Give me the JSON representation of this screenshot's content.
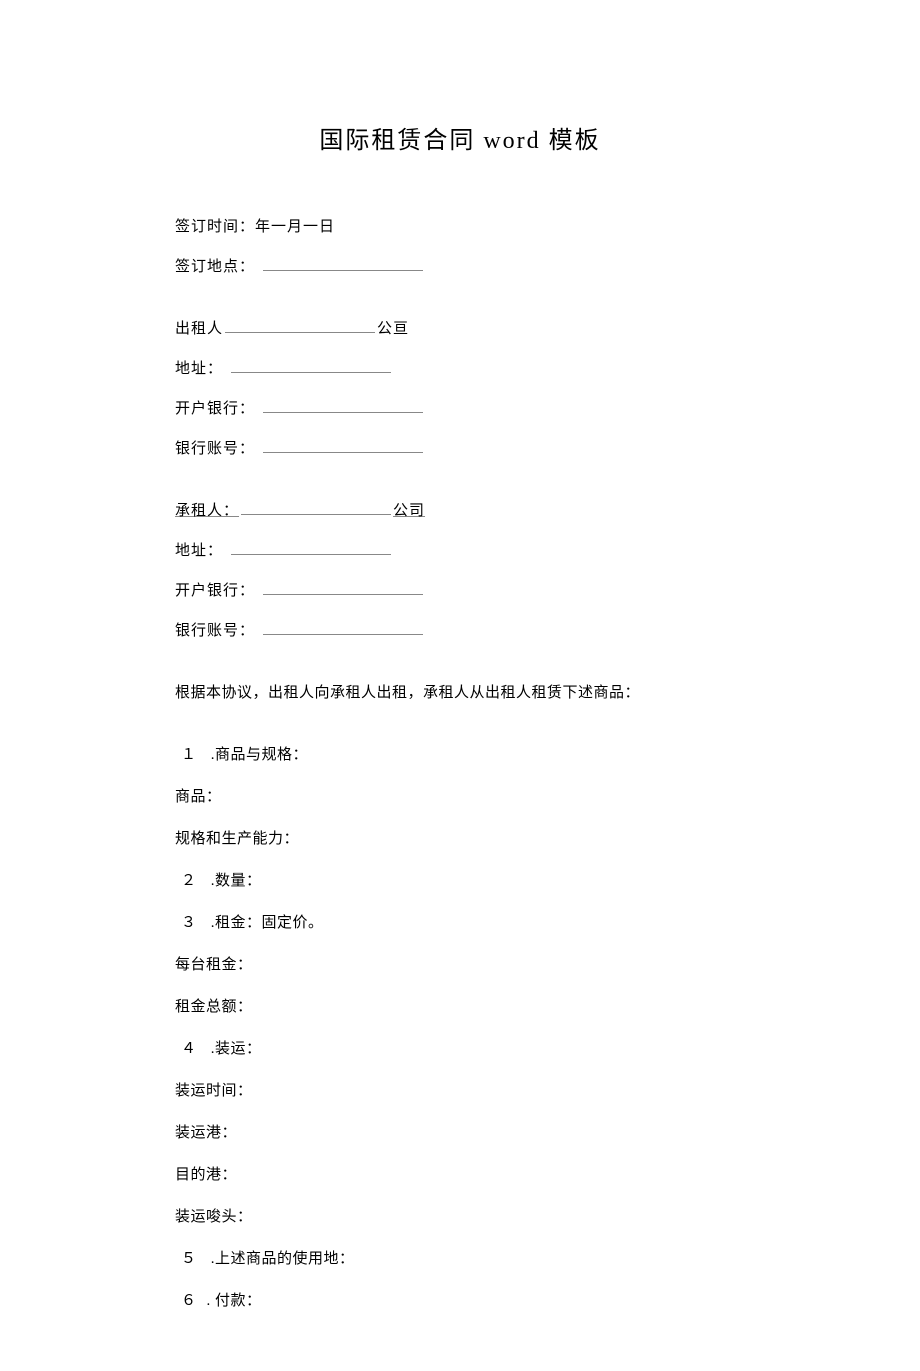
{
  "title": "国际租赁合同 word 模板",
  "signing": {
    "time_label": "签订时间：年一月一日",
    "place_label": "签订地点："
  },
  "lessor": {
    "label": "出租人",
    "company_suffix": "公亘",
    "address_label": "地址：",
    "bank_label": "开户银行：",
    "account_label": "银行账号："
  },
  "lessee": {
    "label": "承租人：",
    "company_suffix": "公司",
    "address_label": "地址：",
    "bank_label": "开户银行：",
    "account_label": "银行账号："
  },
  "intro": "根据本协议，出租人向承租人出租，承租人从出租人租赁下述商品：",
  "items": {
    "n1": "１",
    "t1": " .商品与规格：",
    "goods": "商品：",
    "spec": "规格和生产能力：",
    "n2": "２",
    "t2": " .数量：",
    "n3": "３",
    "t3": " .租金：固定价。",
    "per_unit": "每台租金：",
    "total": "租金总额：",
    "n4": "４",
    "t4": " .装运：",
    "ship_time": "装运时间：",
    "ship_port": "装运港：",
    "dest_port": "目的港：",
    "ship_wharf": "装运唆头：",
    "n5": "５",
    "t5": " .上述商品的使用地：",
    "n6": "６",
    "t6": ". 付款："
  }
}
